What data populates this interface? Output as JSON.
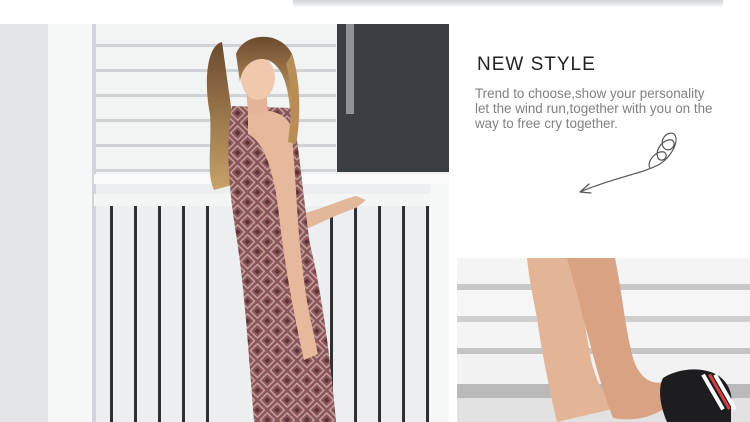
{
  "section": {
    "headline": "NEW STYLE",
    "copy_lines": [
      "Trend to choose,show your personality",
      "let the wind run,together with you on the",
      "way to free cry together."
    ]
  },
  "images": {
    "main_photo": "woman in patterned sleeveless dress beside white fence",
    "detail_photo": "legs with striped platform shoe"
  },
  "colors": {
    "dress": "#8a5558",
    "headline": "#222222",
    "copy": "#808080",
    "background": "#ffffff"
  },
  "icons": {
    "decoration": "swirl-arrow-icon"
  }
}
